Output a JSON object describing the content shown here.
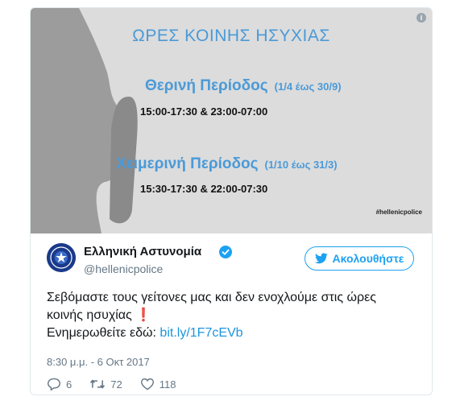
{
  "media": {
    "heading": "ΩΡΕΣ ΚΟΙΝΗΣ ΗΣΥΧΙΑΣ",
    "summer": {
      "title": "Θερινή Περίοδος",
      "range": "(1/4 έως 30/9)",
      "hours": "15:00-17:30 & 23:00-07:00"
    },
    "winter": {
      "title": "Χειμερινή Περίοδος",
      "range": "(1/10 έως 31/3)",
      "hours": "15:30-17:30 & 22:00-07:30"
    },
    "hashtag": "#hellenicpolice",
    "info_icon": "i"
  },
  "tweet": {
    "author_name": "Ελληνική Αστυνομία",
    "handle": "@hellenicpolice",
    "follow_label": "Ακολουθήστε",
    "text_line1": "Σεβόμαστε τους γείτονες μας και δεν ενοχλούμε στις ώρες",
    "text_line2": "κοινής ησυχίας",
    "exclamation": "❗",
    "text_line3": "Ενημερωθείτε εδώ: ",
    "link": "bit.ly/1F7cEVb",
    "timestamp": "8:30 μ.μ. - 6 Οκτ 2017",
    "replies": "6",
    "retweets": "72",
    "likes": "118"
  },
  "colors": {
    "accent": "#1da1f2",
    "heading_blue": "#4a9ad8",
    "link": "#1b95e0"
  },
  "icons": [
    "info-icon",
    "verified-icon",
    "twitter-bird-icon",
    "reply-icon",
    "retweet-icon",
    "like-icon"
  ]
}
